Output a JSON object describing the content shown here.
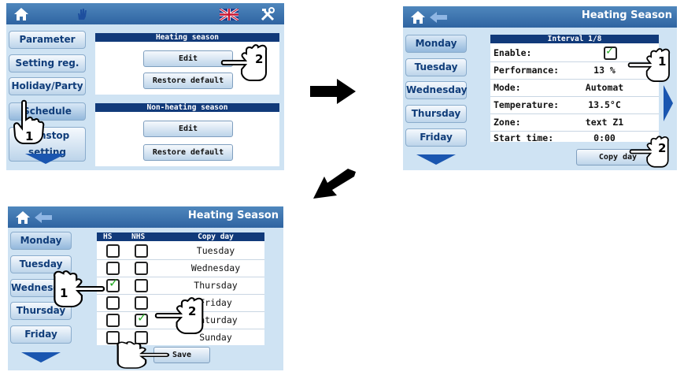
{
  "screen1": {
    "sidebar": [
      "Parameter",
      "Setting reg.",
      "Holiday/Party",
      "Schedule",
      "Nonstop setting"
    ],
    "heating_section": {
      "title": "Heating season",
      "edit": "Edit",
      "restore": "Restore default"
    },
    "nonheating_section": {
      "title": "Non-heating season",
      "edit": "Edit",
      "restore": "Restore default"
    },
    "hand1_number": "1",
    "hand2_number": "2"
  },
  "screen2": {
    "title": "Heating Season",
    "days": [
      "Monday",
      "Tuesday",
      "Wednesday",
      "Thursday",
      "Friday"
    ],
    "interval_header": "Interval 1/8",
    "rows": [
      {
        "label": "Enable:",
        "value": ""
      },
      {
        "label": "Performance:",
        "value": "13 %"
      },
      {
        "label": "Mode:",
        "value": "Automat"
      },
      {
        "label": "Temperature:",
        "value": "13.5°C"
      },
      {
        "label": "Zone:",
        "value": "text Z1"
      },
      {
        "label": "Start time:",
        "value": "0:00"
      }
    ],
    "copy_day": "Copy day",
    "hand1_number": "1",
    "hand2_number": "2"
  },
  "screen3": {
    "title": "Heating Season",
    "days": [
      "Monday",
      "Tuesday",
      "Wednesday",
      "Thursday",
      "Friday"
    ],
    "header": {
      "hs": "HS",
      "nhs": "NHS",
      "copy_day": "Copy day"
    },
    "copy_rows": [
      {
        "day": "Tuesday",
        "hs": false,
        "nhs": false
      },
      {
        "day": "Wednesday",
        "hs": false,
        "nhs": false
      },
      {
        "day": "Thursday",
        "hs": true,
        "nhs": false
      },
      {
        "day": "Friday",
        "hs": false,
        "nhs": false
      },
      {
        "day": "Saturday",
        "hs": false,
        "nhs": true
      },
      {
        "day": "Sunday",
        "hs": false,
        "nhs": false
      }
    ],
    "save": "Save",
    "hand1_number": "1",
    "hand2_number": "2"
  },
  "colors": {
    "topbar": "#2f64a1",
    "panel_head": "#113a7a",
    "screen_bg": "#cfe3f3",
    "check": "#22aa22"
  }
}
